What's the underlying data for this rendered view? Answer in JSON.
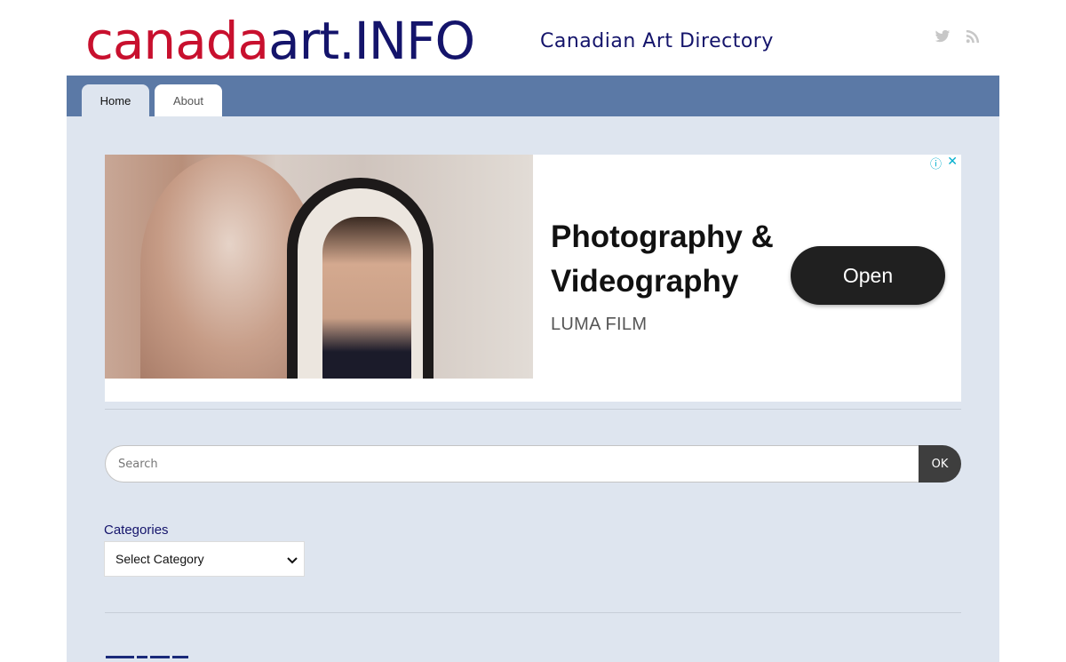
{
  "header": {
    "logo_part1": "canada",
    "logo_part2": "art.INFO",
    "tagline": "Canadian Art Directory",
    "social_icons": [
      "twitter-icon",
      "rss-icon"
    ],
    "colors": {
      "logo_red": "#c8102e",
      "logo_navy": "#14146b"
    }
  },
  "nav": {
    "tabs": [
      {
        "label": "Home",
        "active": true
      },
      {
        "label": "About",
        "active": false
      }
    ],
    "bar_color": "#5b79a6"
  },
  "ad": {
    "headline": "Photography & Videography",
    "advertiser": "LUMA FILM",
    "cta_label": "Open",
    "info_icon": "info-icon",
    "close_icon": "close-icon"
  },
  "search": {
    "placeholder": "Search",
    "button_label": "OK"
  },
  "categories": {
    "label": "Categories",
    "selected": "Select Category"
  },
  "colors": {
    "content_bg": "#dee5ef",
    "page_bg": "#ffffff",
    "button_dark": "#3e3e3e"
  }
}
